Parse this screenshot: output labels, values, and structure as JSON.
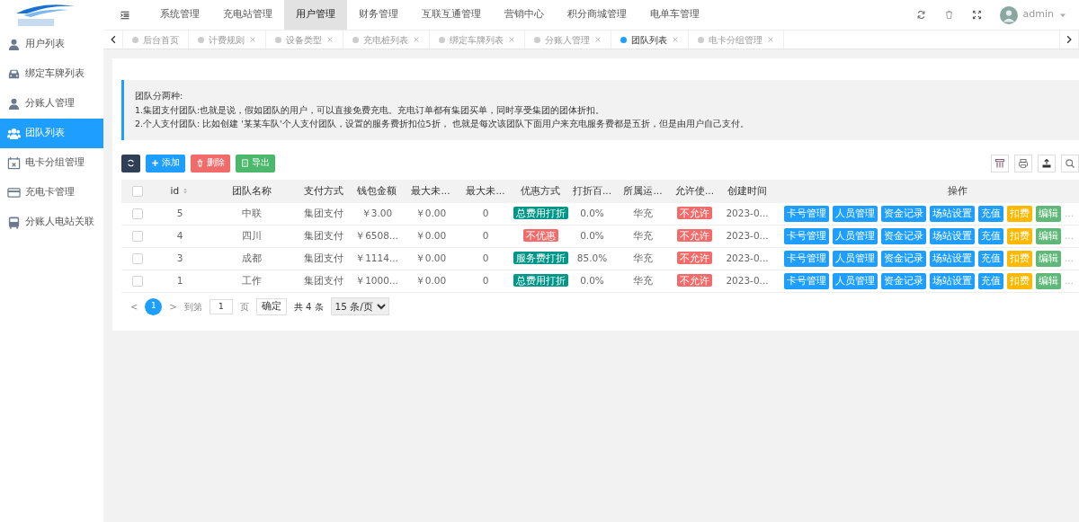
{
  "topnav": [
    {
      "label": "系统管理",
      "selected": false
    },
    {
      "label": "充电站管理",
      "selected": false
    },
    {
      "label": "用户管理",
      "selected": true
    },
    {
      "label": "财务管理",
      "selected": false
    },
    {
      "label": "互联互通管理",
      "selected": false
    },
    {
      "label": "营销中心",
      "selected": false
    },
    {
      "label": "积分商城管理",
      "selected": false
    },
    {
      "label": "电单车管理",
      "selected": false
    }
  ],
  "user": {
    "name": "admin"
  },
  "sidebar": {
    "items": [
      {
        "label": "用户列表",
        "kind": "user",
        "selected": false
      },
      {
        "label": "绑定车牌列表",
        "kind": "car",
        "selected": false
      },
      {
        "label": "分账人管理",
        "kind": "user",
        "selected": false
      },
      {
        "label": "团队列表",
        "kind": "users",
        "selected": true
      },
      {
        "label": "电卡分组管理",
        "kind": "calendar",
        "selected": false
      },
      {
        "label": "充电卡管理",
        "kind": "card",
        "selected": false
      },
      {
        "label": "分账人电站关联",
        "kind": "bus",
        "selected": false
      }
    ]
  },
  "tabs": [
    {
      "label": "后台首页",
      "selected": false,
      "closable": false
    },
    {
      "label": "计费规则",
      "selected": false,
      "closable": true
    },
    {
      "label": "设备类型",
      "selected": false,
      "closable": true
    },
    {
      "label": "充电桩列表",
      "selected": false,
      "closable": true
    },
    {
      "label": "绑定车牌列表",
      "selected": false,
      "closable": true
    },
    {
      "label": "分账人管理",
      "selected": false,
      "closable": true
    },
    {
      "label": "团队列表",
      "selected": true,
      "closable": true
    },
    {
      "label": "电卡分组管理",
      "selected": false,
      "closable": true
    }
  ],
  "notice": {
    "lines": [
      "团队分两种:",
      "1.集团支付团队:也就是说，假如团队的用户，可以直接免费充电。充电订单都有集团买单，同时享受集团的团体折扣。",
      "2.个人支付团队: 比如创建 '某某车队'个人支付团队，设置的服务费折扣位5折， 也就是每次该团队下面用户来充电服务费都是五折，但是由用户自己支付。"
    ]
  },
  "toolbar": [
    {
      "label": "添加",
      "kind": "add"
    },
    {
      "label": "删除",
      "kind": "delete"
    },
    {
      "label": "导出",
      "kind": "export"
    }
  ],
  "table": {
    "select_all": {
      "checked": false
    },
    "columns": [
      "id",
      "团队名称",
      "支付方式",
      "钱包金额",
      "最大未...",
      "最大未...",
      "优惠方式",
      "打折百...",
      "所属运...",
      "允许使...",
      "创建时间",
      "操作"
    ],
    "rows": [
      {
        "checked": false,
        "id": "5",
        "name": "中联",
        "pay": "集团支付",
        "wallet": "￥3.00",
        "max1": "￥0.00",
        "max2": "0",
        "discount": {
          "text": "总费用打折",
          "color": "#009688"
        },
        "pct": "0.0%",
        "operator": "华充",
        "allow": {
          "text": "不允许",
          "color": "#f26b6b"
        },
        "created": "2023-0...",
        "actions": [
          {
            "label": "卡号管理",
            "color": "#1e9fff"
          },
          {
            "label": "人员管理",
            "color": "#1e9fff"
          },
          {
            "label": "资金记录",
            "color": "#1e9fff"
          },
          {
            "label": "场站设置",
            "color": "#1e9fff"
          },
          {
            "label": "充值",
            "color": "#1e9fff"
          },
          {
            "label": "扣费",
            "color": "#ffb800"
          },
          {
            "label": "编辑",
            "color": "#5fb878"
          }
        ],
        "more": "..."
      },
      {
        "checked": false,
        "id": "4",
        "name": "四川",
        "pay": "集团支付",
        "wallet": "￥6508...",
        "max1": "￥0.00",
        "max2": "0",
        "discount": {
          "text": "不优惠",
          "color": "#f26b6b"
        },
        "pct": "0.0%",
        "operator": "华充",
        "allow": {
          "text": "不允许",
          "color": "#f26b6b"
        },
        "created": "2023-0...",
        "actions": [
          {
            "label": "卡号管理",
            "color": "#1e9fff"
          },
          {
            "label": "人员管理",
            "color": "#1e9fff"
          },
          {
            "label": "资金记录",
            "color": "#1e9fff"
          },
          {
            "label": "场站设置",
            "color": "#1e9fff"
          },
          {
            "label": "充值",
            "color": "#1e9fff"
          },
          {
            "label": "扣费",
            "color": "#ffb800"
          },
          {
            "label": "编辑",
            "color": "#5fb878"
          }
        ],
        "more": "..."
      },
      {
        "checked": false,
        "id": "3",
        "name": "成都",
        "pay": "集团支付",
        "wallet": "￥1114...",
        "max1": "￥0.00",
        "max2": "0",
        "discount": {
          "text": "服务费打折",
          "color": "#009688"
        },
        "pct": "85.0%",
        "operator": "华充",
        "allow": {
          "text": "不允许",
          "color": "#f26b6b"
        },
        "created": "2023-0...",
        "actions": [
          {
            "label": "卡号管理",
            "color": "#1e9fff"
          },
          {
            "label": "人员管理",
            "color": "#1e9fff"
          },
          {
            "label": "资金记录",
            "color": "#1e9fff"
          },
          {
            "label": "场站设置",
            "color": "#1e9fff"
          },
          {
            "label": "充值",
            "color": "#1e9fff"
          },
          {
            "label": "扣费",
            "color": "#ffb800"
          },
          {
            "label": "编辑",
            "color": "#5fb878"
          }
        ],
        "more": "..."
      },
      {
        "checked": false,
        "id": "1",
        "name": "工作",
        "pay": "集团支付",
        "wallet": "￥1000...",
        "max1": "￥0.00",
        "max2": "0",
        "discount": {
          "text": "总费用打折",
          "color": "#009688"
        },
        "pct": "0.0%",
        "operator": "华充",
        "allow": {
          "text": "不允许",
          "color": "#f26b6b"
        },
        "created": "2023-0...",
        "actions": [
          {
            "label": "卡号管理",
            "color": "#1e9fff"
          },
          {
            "label": "人员管理",
            "color": "#1e9fff"
          },
          {
            "label": "资金记录",
            "color": "#1e9fff"
          },
          {
            "label": "场站设置",
            "color": "#1e9fff"
          },
          {
            "label": "充值",
            "color": "#1e9fff"
          },
          {
            "label": "扣费",
            "color": "#ffb800"
          },
          {
            "label": "编辑",
            "color": "#5fb878"
          }
        ],
        "more": "..."
      }
    ]
  },
  "pager": {
    "prev": "<",
    "page": "1",
    "next": ">",
    "goto": "到第",
    "input": "1",
    "page_unit": "页",
    "confirm": "确定",
    "total": "共 4 条",
    "size": "15 条/页"
  }
}
